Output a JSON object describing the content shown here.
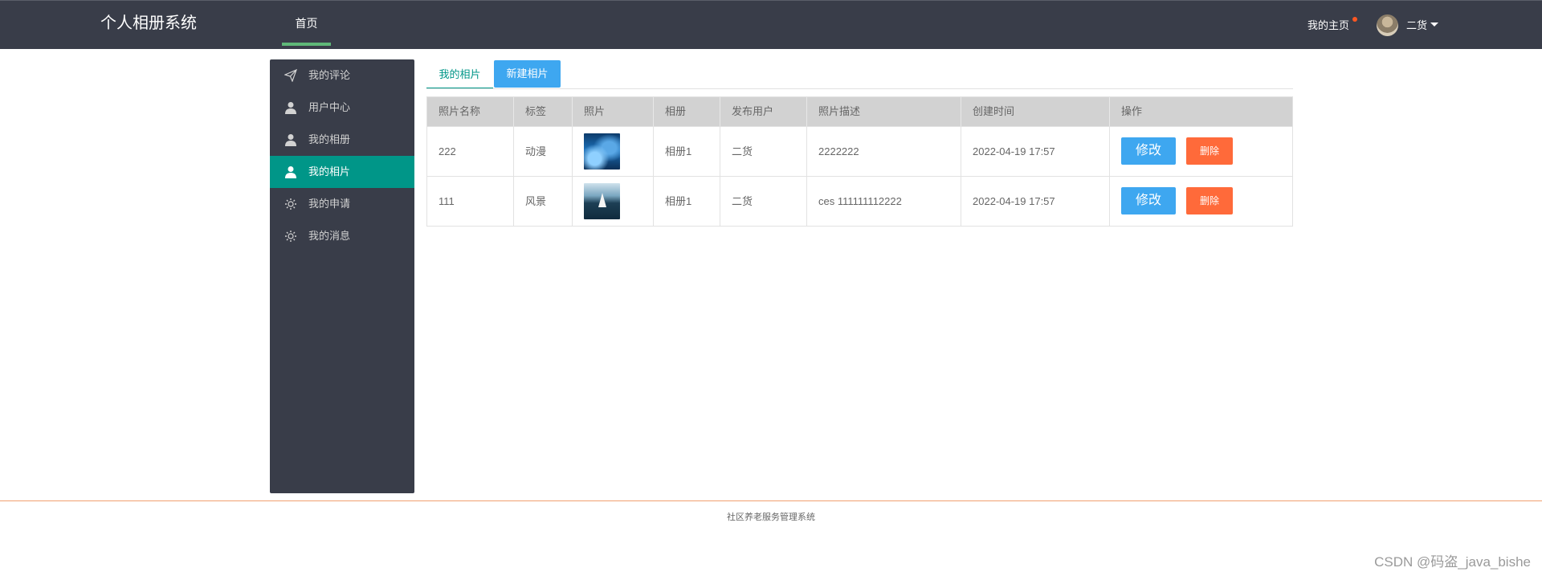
{
  "header": {
    "app_title": "个人相册系统",
    "nav_home": "首页",
    "my_home": "我的主页",
    "user_name": "二货",
    "accent_color": "#5fb878"
  },
  "sidebar": {
    "items": [
      {
        "label": "我的评论",
        "icon": "paper-plane-icon",
        "active": false
      },
      {
        "label": "用户中心",
        "icon": "user-icon",
        "active": false
      },
      {
        "label": "我的相册",
        "icon": "user-icon",
        "active": false
      },
      {
        "label": "我的相片",
        "icon": "user-icon",
        "active": true
      },
      {
        "label": "我的申请",
        "icon": "gear-icon",
        "active": false
      },
      {
        "label": "我的消息",
        "icon": "gear-icon",
        "active": false
      }
    ],
    "active_color": "#009688"
  },
  "tabs": {
    "mine": "我的相片",
    "new": "新建相片"
  },
  "table": {
    "columns": [
      "照片名称",
      "标签",
      "照片",
      "相册",
      "发布用户",
      "照片描述",
      "创建时间",
      "操作"
    ],
    "rows": [
      {
        "name": "222",
        "tag": "动漫",
        "photo": "anime-photo",
        "album": "相册1",
        "user": "二货",
        "desc": "2222222",
        "created": "2022-04-19 17:57"
      },
      {
        "name": "111",
        "tag": "风景",
        "photo": "landscape-photo",
        "album": "相册1",
        "user": "二货",
        "desc": "ces 111111112222",
        "created": "2022-04-19 17:57"
      }
    ],
    "edit_label": "修改",
    "delete_label": "删除"
  },
  "footer": {
    "text": "社区养老服务管理系统"
  },
  "watermark": "CSDN @码盗_java_bishe"
}
